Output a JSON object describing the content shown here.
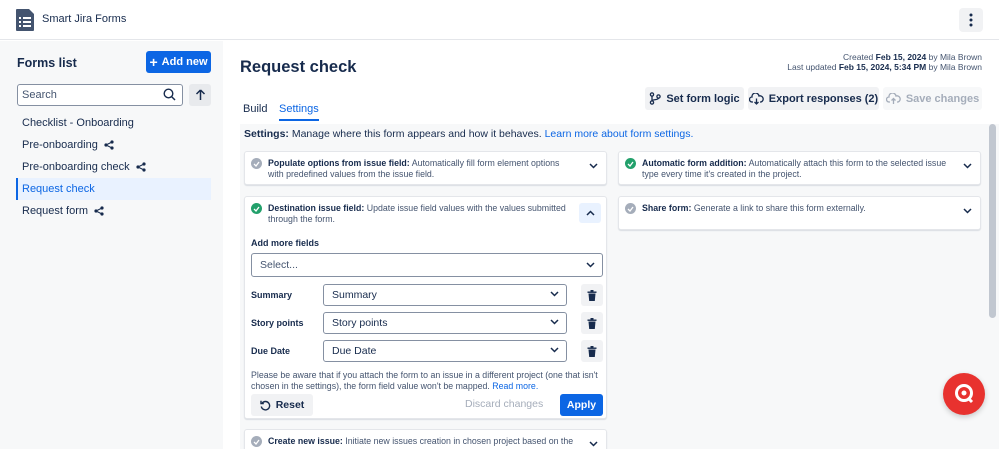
{
  "app": {
    "title": "Smart Jira Forms",
    "more_icon": "more-vertical-icon"
  },
  "sidebar": {
    "title": "Forms list",
    "add_new_label": "Add new",
    "search_placeholder": "Search",
    "items": [
      {
        "label": "Checklist - Onboarding",
        "shared": false,
        "active": false
      },
      {
        "label": "Pre-onboarding",
        "shared": true,
        "active": false
      },
      {
        "label": "Pre-onboarding check",
        "shared": true,
        "active": false
      },
      {
        "label": "Request check",
        "shared": false,
        "active": true
      },
      {
        "label": "Request form",
        "shared": true,
        "active": false
      }
    ]
  },
  "page": {
    "title": "Request check",
    "created_prefix": "Created",
    "created_date": "Feb 15, 2024",
    "created_by": "by Mila Brown",
    "updated_prefix": "Last updated",
    "updated_date": "Feb 15, 2024, 5:34 PM",
    "updated_by": "by Mila Brown"
  },
  "tabs": [
    {
      "label": "Build",
      "active": false
    },
    {
      "label": "Settings",
      "active": true
    }
  ],
  "toolbar": {
    "form_logic_label": "Set form logic",
    "export_label": "Export responses (2)",
    "save_label": "Save changes"
  },
  "settings": {
    "intro_bold": "Settings:",
    "intro_text": "Manage where this form appears and how it behaves.",
    "intro_link": "Learn more about form settings.",
    "populate": {
      "title": "Populate options from issue field:",
      "desc": "Automatically fill form element options with predefined values from the issue field.",
      "enabled": false
    },
    "destination": {
      "title": "Destination issue field:",
      "desc": "Update issue field values with the values submitted through the form.",
      "enabled": true,
      "add_more_label": "Add more fields",
      "select_placeholder": "Select...",
      "fields": [
        {
          "label": "Summary",
          "value": "Summary"
        },
        {
          "label": "Story points",
          "value": "Story points"
        },
        {
          "label": "Due Date",
          "value": "Due Date"
        }
      ],
      "note": "Please be aware that if you attach the form to an issue in a different project (one that isn't chosen in the settings), the form field value won't be mapped.",
      "note_link": "Read more.",
      "reset_label": "Reset",
      "discard_label": "Discard changes",
      "apply_label": "Apply"
    },
    "create_issue": {
      "title": "Create new issue:",
      "desc": "Initiate new issues creation in chosen project based on the",
      "enabled": false
    },
    "auto_add": {
      "title": "Automatic form addition:",
      "desc": "Automatically attach this form to the selected issue type every time it's created in the project.",
      "enabled": true
    },
    "share": {
      "title": "Share form:",
      "desc": "Generate a link to share this form externally.",
      "enabled": false
    }
  },
  "colors": {
    "accent": "#0c66e4",
    "success": "#22a06b",
    "fab": "#e8322f"
  }
}
